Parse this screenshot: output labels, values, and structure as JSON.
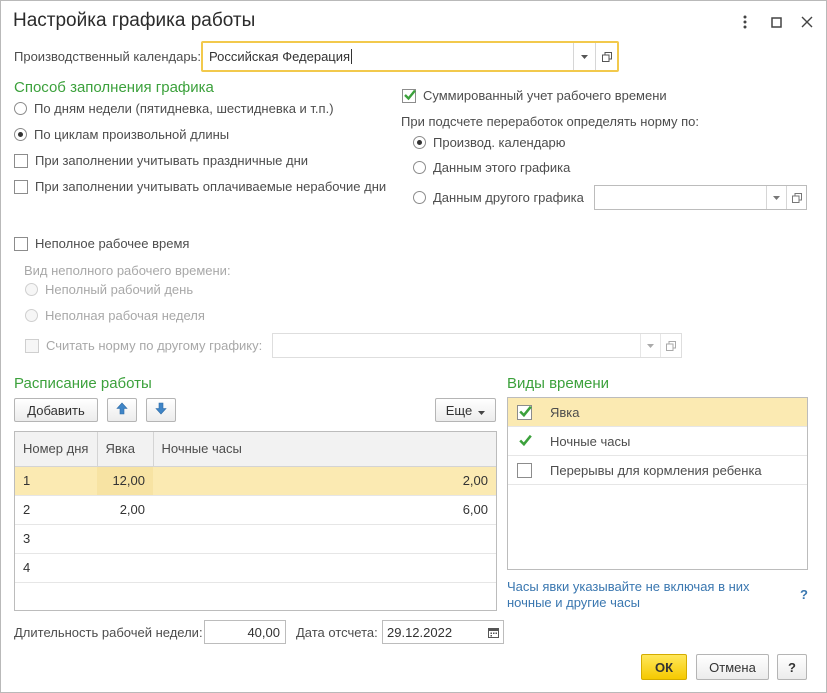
{
  "window": {
    "title": "Настройка графика работы",
    "controls": [
      "more-icon",
      "maximize-icon",
      "close-icon"
    ]
  },
  "calendar": {
    "label": "Производственный календарь:",
    "value": "Российская Федерация"
  },
  "fill_method": {
    "title": "Способ заполнения графика",
    "options": [
      {
        "label": "По дням недели (пятидневка, шестидневка и т.п.)",
        "selected": false
      },
      {
        "label": "По циклам произвольной длины",
        "selected": true
      }
    ],
    "consider_holidays": {
      "label": "При заполнении учитывать праздничные дни",
      "checked": false
    },
    "consider_paid_nonworking": {
      "label": "При заполнении учитывать оплачиваемые нерабочие дни",
      "checked": false
    }
  },
  "summarized": {
    "label": "Суммированный учет рабочего времени",
    "checked": true,
    "norm_label": "При подсчете переработок определять норму по:",
    "options": [
      {
        "label": "Производ. календарю",
        "selected": true
      },
      {
        "label": "Данным этого графика",
        "selected": false
      },
      {
        "label": "Данным другого графика",
        "selected": false
      }
    ],
    "other_schedule_value": ""
  },
  "part_time": {
    "label": "Неполное рабочее время",
    "checked": false,
    "kind_label": "Вид неполного рабочего времени:",
    "options": [
      {
        "label": "Неполный рабочий день"
      },
      {
        "label": "Неполная рабочая неделя"
      }
    ],
    "norm_other_label": "Считать норму по другому графику:",
    "norm_other_value": ""
  },
  "schedule": {
    "title": "Расписание работы",
    "add_label": "Добавить",
    "more_label": "Еще",
    "columns": [
      "Номер дня",
      "Явка",
      "Ночные часы"
    ],
    "rows": [
      {
        "day": "1",
        "attendance": "12,00",
        "night": "2,00",
        "selected": true
      },
      {
        "day": "2",
        "attendance": "2,00",
        "night": "6,00",
        "selected": false
      },
      {
        "day": "3",
        "attendance": "",
        "night": "",
        "selected": false
      },
      {
        "day": "4",
        "attendance": "",
        "night": "",
        "selected": false
      }
    ]
  },
  "time_types": {
    "title": "Виды времени",
    "items": [
      {
        "label": "Явка",
        "checked": true,
        "selected": true
      },
      {
        "label": "Ночные часы",
        "checked": true,
        "selected": false
      },
      {
        "label": "Перерывы для кормления ребенка",
        "checked": false,
        "selected": false
      }
    ],
    "hint": "Часы явки указывайте не включая в них ночные и другие часы",
    "help_mark": "?"
  },
  "footer": {
    "week_length_label": "Длительность рабочей недели:",
    "week_length_value": "40,00",
    "ref_date_label": "Дата отсчета:",
    "ref_date_value": "29.12.2022",
    "ok_label": "ОК",
    "cancel_label": "Отмена",
    "help_label": "?"
  },
  "colors": {
    "accent_green": "#3ca13c",
    "focus_yellow": "#f2c94c",
    "selection": "#fbeab2",
    "link_blue": "#3a77b0"
  }
}
